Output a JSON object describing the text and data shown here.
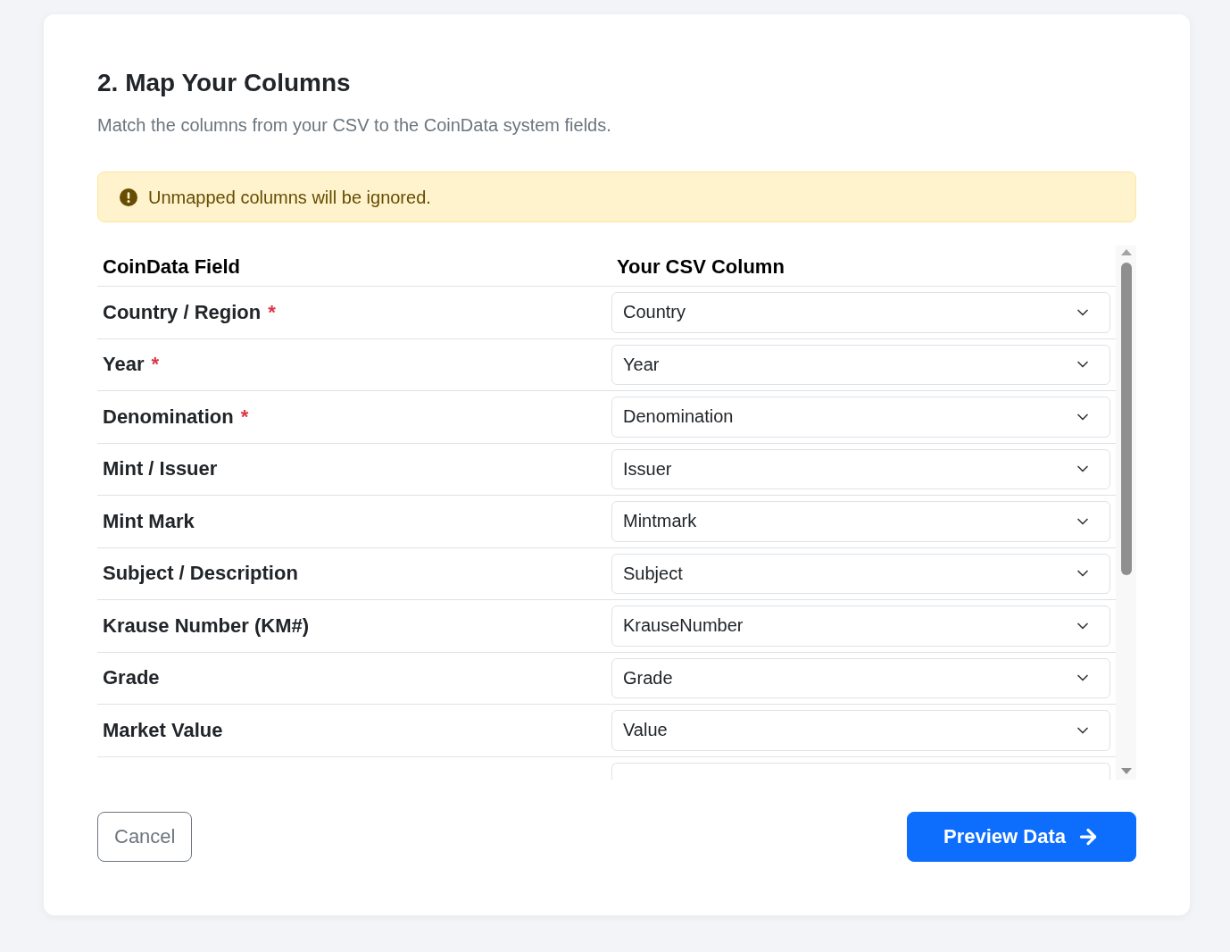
{
  "heading": {
    "title": "2. Map Your Columns",
    "subtitle": "Match the columns from your CSV to the CoinData system fields."
  },
  "alert": {
    "kind": "warning",
    "text": "Unmapped columns will be ignored."
  },
  "table": {
    "columns": [
      "CoinData Field",
      "Your CSV Column"
    ],
    "required_mark": "*",
    "rows": [
      {
        "field": "Country / Region",
        "required": true,
        "value": "Country"
      },
      {
        "field": "Year",
        "required": true,
        "value": "Year"
      },
      {
        "field": "Denomination",
        "required": true,
        "value": "Denomination"
      },
      {
        "field": "Mint / Issuer",
        "required": false,
        "value": "Issuer"
      },
      {
        "field": "Mint Mark",
        "required": false,
        "value": "Mintmark"
      },
      {
        "field": "Subject / Description",
        "required": false,
        "value": "Subject"
      },
      {
        "field": "Krause Number (KM#)",
        "required": false,
        "value": "KrauseNumber"
      },
      {
        "field": "Grade",
        "required": false,
        "value": "Grade"
      },
      {
        "field": "Market Value",
        "required": false,
        "value": "Value"
      }
    ]
  },
  "buttons": [
    {
      "kind": "secondary",
      "label": "Cancel"
    },
    {
      "kind": "primary",
      "label": "Preview Data"
    }
  ]
}
